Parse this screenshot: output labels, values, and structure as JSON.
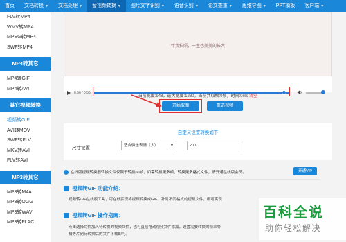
{
  "nav": {
    "items": [
      {
        "label": "首页",
        "caret": false,
        "active": false
      },
      {
        "label": "文档转换",
        "caret": true,
        "active": false
      },
      {
        "label": "文档处理",
        "caret": true,
        "active": false
      },
      {
        "label": "音视频转换",
        "caret": true,
        "active": true
      },
      {
        "label": "图片文字识别",
        "caret": true,
        "active": false
      },
      {
        "label": "语音识别",
        "caret": true,
        "active": false
      },
      {
        "label": "论文查重",
        "caret": true,
        "active": false
      },
      {
        "label": "思维导图",
        "caret": true,
        "active": false
      },
      {
        "label": "PPT模板",
        "caret": false,
        "active": false
      },
      {
        "label": "客户端",
        "caret": true,
        "active": false
      }
    ]
  },
  "sidebar": {
    "group1": [
      "FLV转MP4",
      "WMV转MP4",
      "MPEG转MP4",
      "SWF转MP4"
    ],
    "section1": "MP4转其它",
    "group2": [
      "MP4转GIF",
      "MP4转AVI"
    ],
    "section2": "其它视频转换",
    "group3": [
      "视频转GIF",
      "AVI转MOV",
      "SWF转FLV",
      "MKV转AVI",
      "FLV转AVI"
    ],
    "section3": "MP3转其它",
    "group4": [
      "MP3转M4A",
      "MP3转OGG",
      "MP3转WAV",
      "MP3转FLAC"
    ]
  },
  "video": {
    "caption": "伴我拍照，一生也美美的长大",
    "time": "0:56 / 0:56",
    "progress": 0.98
  },
  "info": {
    "text": "当前宽度:948，最大宽度:1280，当前共取帧:0帧，时间:0ms",
    "clear": "清空"
  },
  "buttons": {
    "start": "开始取图",
    "reselect": "重选视频"
  },
  "settings": {
    "title": "自定义设置转换如下",
    "size_label": "尺寸设置",
    "select_value": "适合微信表情（大）",
    "size_value": "200"
  },
  "notice": {
    "text": "在线版视频转换器转换文件仅限于转换60帧，如需转换更多帧，转换更多格式文件，请开通在线版会员。",
    "vip": "开通VIP"
  },
  "intro": {
    "title": "视频转GIF 功能介绍：",
    "body": "视频转GIF在线版工具，可在线实现将视频转换成GIF，针对不同格式的视频文件，都可实现"
  },
  "guide": {
    "title": "视频转GIF 操作指南：",
    "body1": "点击选择文件加入待转换的视频文件，也可直接拖动视频文件添加，设置需要转换的帧率等",
    "body2": "稍等片刻待转换后的文件下载即可。"
  },
  "watermark": {
    "main": "百科全说",
    "sub": "助你轻松解决"
  }
}
